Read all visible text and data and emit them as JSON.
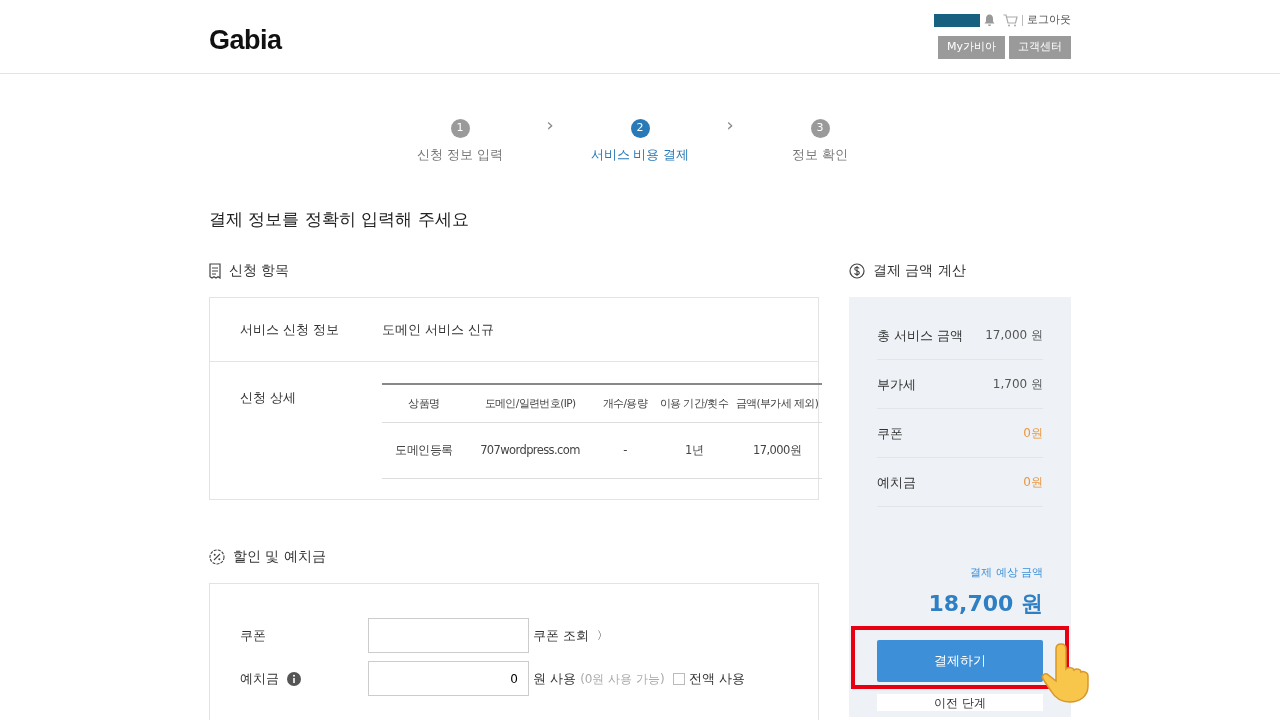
{
  "header": {
    "logo": "Gabia",
    "logout": "로그아웃",
    "buttons": [
      "My가비아",
      "고객센터"
    ]
  },
  "steps": [
    {
      "number": "1",
      "label": "신청 정보 입력",
      "selected": false
    },
    {
      "number": "2",
      "label": "서비스 비용 결제",
      "selected": true
    },
    {
      "number": "3",
      "label": "정보 확인",
      "selected": false
    }
  ],
  "step_separator": "›",
  "page_title": "결제 정보를 정확히 입력해 주세요",
  "order_section": {
    "title": "신청 항목",
    "service_label": "서비스 신청 정보",
    "service_value": "도메인 서비스 신규",
    "detail_label": "신청 상세",
    "table": {
      "columns": [
        "상품명",
        "도메인/일련번호(IP)",
        "개수/용량",
        "이용 기간/횟수",
        "금액(부가세 제외)"
      ],
      "rows": [
        [
          "도메인등록",
          "707wordpress.com",
          "-",
          "1년",
          "17,000원"
        ]
      ]
    }
  },
  "discount_section": {
    "title": "할인 및 예치금",
    "coupon": {
      "label": "쿠폰",
      "lookup": "쿠폰 조회",
      "chevron": "〉"
    },
    "deposit": {
      "label": "예치금",
      "value": "0",
      "unit": "원 사용",
      "available": "(0원 사용 가능)",
      "full_use": {
        "label": "전액 사용",
        "checked": false
      }
    }
  },
  "summary": {
    "title": "결제 금액 계산",
    "rows": [
      {
        "label": "총 서비스 금액",
        "value": "17,000 원",
        "kind": "amount"
      },
      {
        "label": "부가세",
        "value": "1,700 원",
        "kind": "amount"
      },
      {
        "label": "쿠폰",
        "value": "0원",
        "kind": "discount"
      },
      {
        "label": "예치금",
        "value": "0원",
        "kind": "discount"
      }
    ],
    "estimate_label": "결제 예상 금액",
    "estimate_amount": "18,700 원",
    "pay_button": "결제하기",
    "prev_button": "이전 단계"
  }
}
